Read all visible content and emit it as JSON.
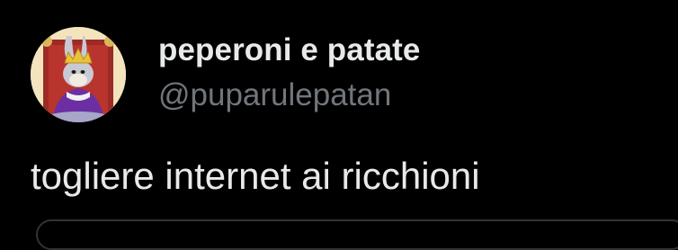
{
  "tweet": {
    "author": {
      "display_name": "peperoni e patate",
      "handle": "@puparulepatan",
      "avatar_icon": "bugs-bunny-king-avatar"
    },
    "text": "togliere internet ai ricchioni"
  },
  "colors": {
    "background": "#000000",
    "primary_text": "#e7e9ea",
    "secondary_text": "#71767b",
    "border": "#2f3336"
  }
}
